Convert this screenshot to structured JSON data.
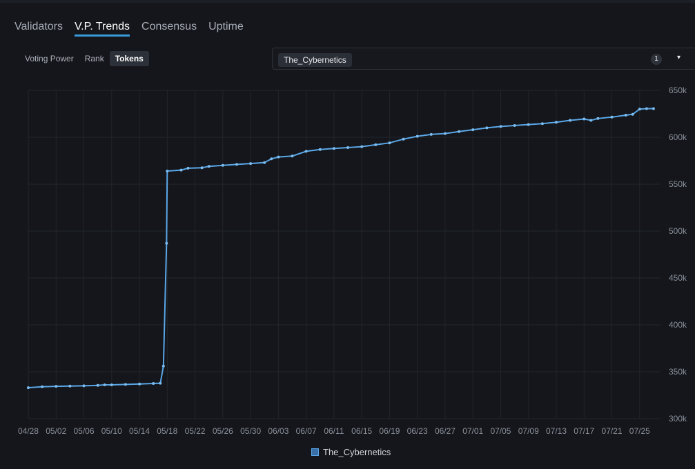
{
  "tabs": [
    {
      "label": "Validators",
      "active": false
    },
    {
      "label": "V.P. Trends",
      "active": true
    },
    {
      "label": "Consensus",
      "active": false
    },
    {
      "label": "Uptime",
      "active": false
    }
  ],
  "segments": [
    {
      "label": "Voting Power",
      "active": false
    },
    {
      "label": "Rank",
      "active": false
    },
    {
      "label": "Tokens",
      "active": true
    }
  ],
  "selector": {
    "chip": "The_Cybernetics",
    "count": "1",
    "caret": "▾"
  },
  "legend": {
    "label": "The_Cybernetics"
  },
  "colors": {
    "accent": "#3a9bdc",
    "line": "#5aa7e8",
    "background": "#14161b"
  },
  "chart_data": {
    "type": "line",
    "title": "",
    "xlabel": "",
    "ylabel": "",
    "ylim": [
      300000,
      650000
    ],
    "y_ticks": [
      "650k",
      "600k",
      "550k",
      "500k",
      "450k",
      "400k",
      "350k",
      "300k"
    ],
    "x_ticks": [
      "04/28",
      "05/02",
      "05/06",
      "05/10",
      "05/14",
      "05/18",
      "05/22",
      "05/26",
      "05/30",
      "06/03",
      "06/07",
      "06/11",
      "06/15",
      "06/19",
      "06/23",
      "06/27",
      "07/01",
      "07/05",
      "07/09",
      "07/13",
      "07/17",
      "07/21",
      "07/25"
    ],
    "grid": true,
    "legend_position": "bottom-center",
    "series": [
      {
        "name": "The_Cybernetics",
        "points": [
          [
            "04/28",
            333000
          ],
          [
            "04/30",
            334000
          ],
          [
            "05/02",
            334500
          ],
          [
            "05/04",
            334800
          ],
          [
            "05/06",
            335000
          ],
          [
            "05/08",
            335500
          ],
          [
            "05/09",
            336000
          ],
          [
            "05/10",
            336000
          ],
          [
            "05/12",
            336500
          ],
          [
            "05/14",
            337000
          ],
          [
            "05/16",
            337500
          ],
          [
            "05/17",
            337800
          ],
          [
            "05/17",
            356000
          ],
          [
            "05/17",
            487000
          ],
          [
            "05/18",
            564000
          ],
          [
            "05/20",
            565000
          ],
          [
            "05/21",
            567000
          ],
          [
            "05/23",
            567500
          ],
          [
            "05/24",
            569000
          ],
          [
            "05/26",
            570000
          ],
          [
            "05/28",
            571000
          ],
          [
            "05/30",
            572000
          ],
          [
            "06/01",
            573000
          ],
          [
            "06/02",
            577000
          ],
          [
            "06/03",
            579000
          ],
          [
            "06/05",
            580000
          ],
          [
            "06/07",
            585000
          ],
          [
            "06/09",
            587000
          ],
          [
            "06/11",
            588000
          ],
          [
            "06/13",
            589000
          ],
          [
            "06/15",
            590000
          ],
          [
            "06/17",
            592000
          ],
          [
            "06/19",
            594000
          ],
          [
            "06/21",
            598000
          ],
          [
            "06/23",
            601000
          ],
          [
            "06/25",
            603000
          ],
          [
            "06/27",
            604000
          ],
          [
            "06/29",
            606000
          ],
          [
            "07/01",
            608000
          ],
          [
            "07/03",
            610000
          ],
          [
            "07/05",
            611500
          ],
          [
            "07/07",
            612500
          ],
          [
            "07/09",
            613500
          ],
          [
            "07/11",
            614500
          ],
          [
            "07/13",
            616000
          ],
          [
            "07/15",
            618000
          ],
          [
            "07/17",
            619500
          ],
          [
            "07/18",
            618000
          ],
          [
            "07/19",
            620000
          ],
          [
            "07/21",
            621500
          ],
          [
            "07/23",
            623500
          ],
          [
            "07/24",
            624500
          ],
          [
            "07/25",
            630000
          ],
          [
            "07/26",
            630500
          ],
          [
            "07/27",
            630500
          ]
        ]
      }
    ]
  }
}
